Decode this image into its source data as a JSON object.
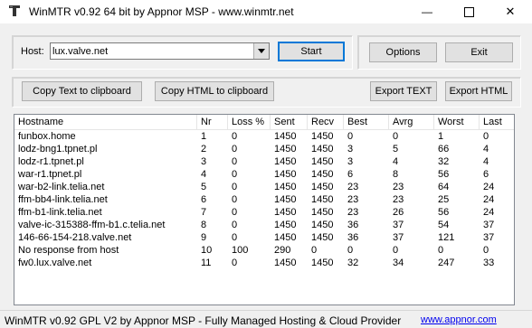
{
  "window": {
    "title": "WinMTR v0.92 64 bit by Appnor MSP - www.winmtr.net",
    "minimize_glyph": "—",
    "maximize_glyph": "☐",
    "close_glyph": "✕"
  },
  "host": {
    "label": "Host:",
    "value": "lux.valve.net"
  },
  "buttons": {
    "start": "Start",
    "options": "Options",
    "exit": "Exit",
    "copy_text": "Copy Text to clipboard",
    "copy_html": "Copy HTML to clipboard",
    "export_text": "Export TEXT",
    "export_html": "Export HTML"
  },
  "table": {
    "columns": [
      "Hostname",
      "Nr",
      "Loss %",
      "Sent",
      "Recv",
      "Best",
      "Avrg",
      "Worst",
      "Last"
    ],
    "rows": [
      [
        "funbox.home",
        "1",
        "0",
        "1450",
        "1450",
        "0",
        "0",
        "1",
        "0"
      ],
      [
        "lodz-bng1.tpnet.pl",
        "2",
        "0",
        "1450",
        "1450",
        "3",
        "5",
        "66",
        "4"
      ],
      [
        "lodz-r1.tpnet.pl",
        "3",
        "0",
        "1450",
        "1450",
        "3",
        "4",
        "32",
        "4"
      ],
      [
        "war-r1.tpnet.pl",
        "4",
        "0",
        "1450",
        "1450",
        "6",
        "8",
        "56",
        "6"
      ],
      [
        "war-b2-link.telia.net",
        "5",
        "0",
        "1450",
        "1450",
        "23",
        "23",
        "64",
        "24"
      ],
      [
        "ffm-bb4-link.telia.net",
        "6",
        "0",
        "1450",
        "1450",
        "23",
        "23",
        "25",
        "24"
      ],
      [
        "ffm-b1-link.telia.net",
        "7",
        "0",
        "1450",
        "1450",
        "23",
        "26",
        "56",
        "24"
      ],
      [
        "valve-ic-315388-ffm-b1.c.telia.net",
        "8",
        "0",
        "1450",
        "1450",
        "36",
        "37",
        "54",
        "37"
      ],
      [
        "146-66-154-218.valve.net",
        "9",
        "0",
        "1450",
        "1450",
        "36",
        "37",
        "121",
        "37"
      ],
      [
        "No response from host",
        "10",
        "100",
        "290",
        "0",
        "0",
        "0",
        "0",
        "0"
      ],
      [
        "fw0.lux.valve.net",
        "11",
        "0",
        "1450",
        "1450",
        "32",
        "34",
        "247",
        "33"
      ]
    ]
  },
  "status": {
    "text": "WinMTR v0.92 GPL V2 by Appnor MSP - Fully Managed Hosting & Cloud Provider",
    "link": "www.appnor.com"
  }
}
